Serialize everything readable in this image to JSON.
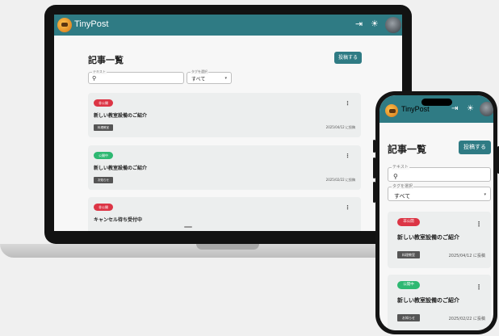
{
  "app": {
    "name": "TinyPost"
  },
  "icons": {
    "logo": "mascot-logo",
    "logout": "logout-icon",
    "theme": "sun-icon",
    "avatar": "user-avatar",
    "search": "search-icon",
    "menu": "more-vert-icon",
    "dropdown": "chevron-down-icon"
  },
  "glyphs": {
    "logout": "⇥",
    "theme": "☀",
    "search": "⚲",
    "menu": "⋮",
    "caret": "▾"
  },
  "page": {
    "title": "記事一覧",
    "post_button": "投稿する",
    "search_label": "テキスト",
    "tag_label": "タグを選択",
    "tag_value": "すべて"
  },
  "colors": {
    "appbar": "#2f7b84",
    "private_badge": "#dc3545",
    "public_badge": "#2eb872"
  },
  "laptop_posts": [
    {
      "status": "非公開",
      "status_type": "private",
      "title": "新しい教室設備のご紹介",
      "tag": "料理教室",
      "date": "2025/04/12 に投稿"
    },
    {
      "status": "公開中",
      "status_type": "public",
      "title": "新しい教室設備のご紹介",
      "tag": "お知らせ",
      "date": "2025/02/22 に投稿"
    },
    {
      "status": "非公開",
      "status_type": "private",
      "title": "キャンセル待ち受付中"
    }
  ],
  "phone_posts": [
    {
      "status": "非公開",
      "status_type": "private",
      "title": "新しい教室設備のご紹介",
      "tag": "料理教室",
      "date": "2025/04/12 に投稿"
    },
    {
      "status": "公開中",
      "status_type": "public",
      "title": "新しい教室設備のご紹介",
      "tag": "お知らせ",
      "date": "2025/02/22 に投稿"
    }
  ]
}
